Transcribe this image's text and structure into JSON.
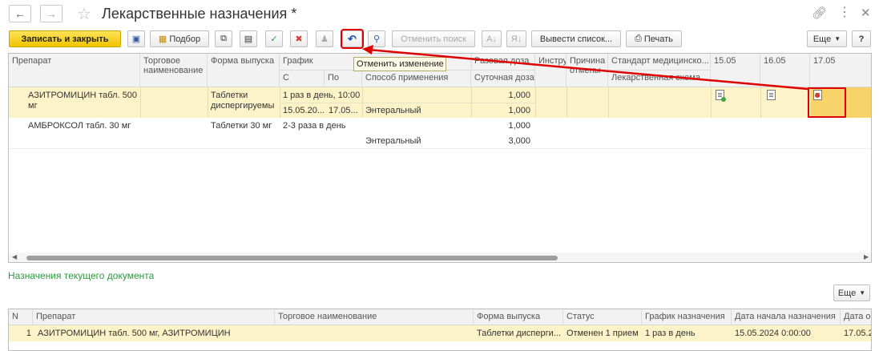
{
  "window": {
    "title": "Лекарственные назначения *"
  },
  "toolbar": {
    "save_close": "Записать и закрыть",
    "podbor": "Подбор",
    "cancel_search": "Отменить поиск",
    "output_list": "Вывести список...",
    "print": "Печать",
    "more": "Еще",
    "help": "?"
  },
  "tooltip": "Отменить изменение",
  "table": {
    "headers": {
      "preparat": "Препарат",
      "trade_name": "Торговое наименование",
      "form": "Форма выпуска",
      "schedule": "График",
      "from": "С",
      "to": "По",
      "method": "Способ применения",
      "single_dose": "Разовая доза",
      "daily_dose": "Суточная доза",
      "instruction": "Инструкция",
      "cancel_reason": "Причина отмены",
      "standard": "Стандарт медицинско...",
      "drug_scheme": "Лекарственная схема",
      "d1": "15.05",
      "d2": "16.05",
      "d3": "17.05"
    },
    "rows": [
      {
        "preparat": "АЗИТРОМИЦИН табл. 500 мг",
        "form": "Таблетки диспергируемы",
        "schedule": "1 раз в день, 10:00",
        "from": "15.05.20...",
        "to": "17.05...",
        "method": "Энтеральный",
        "single_dose": "1,000",
        "daily_dose": "1,000"
      },
      {
        "preparat": "АМБРОКСОЛ табл. 30 мг",
        "form": "Таблетки 30 мг",
        "schedule": "2-3 раза в день",
        "method": "Энтеральный",
        "single_dose": "1,000",
        "daily_dose": "3,000"
      }
    ]
  },
  "section": {
    "title": "Назначения текущего документа",
    "more": "Еще"
  },
  "table2": {
    "headers": {
      "n": "N",
      "preparat": "Препарат",
      "trade_name": "Торговое наименование",
      "form": "Форма выпуска",
      "status": "Статус",
      "schedule": "График назначения",
      "start_date": "Дата начала назначения",
      "date2": "Дата о"
    },
    "rows": [
      {
        "n": "1",
        "preparat": "АЗИТРОМИЦИН табл. 500 мг, АЗИТРОМИЦИН",
        "trade_name": "",
        "form": "Таблетки дисперги...",
        "status": "Отменен 1 прием",
        "schedule": "1 раз в день",
        "start_date": "15.05.2024 0:00:00",
        "date2": "17.05.2"
      }
    ]
  },
  "colors": {
    "accent_yellow": "#f0c400",
    "highlight_red": "#e00000",
    "section_green": "#2e9a3f",
    "row_selected": "#fdf3c8"
  }
}
